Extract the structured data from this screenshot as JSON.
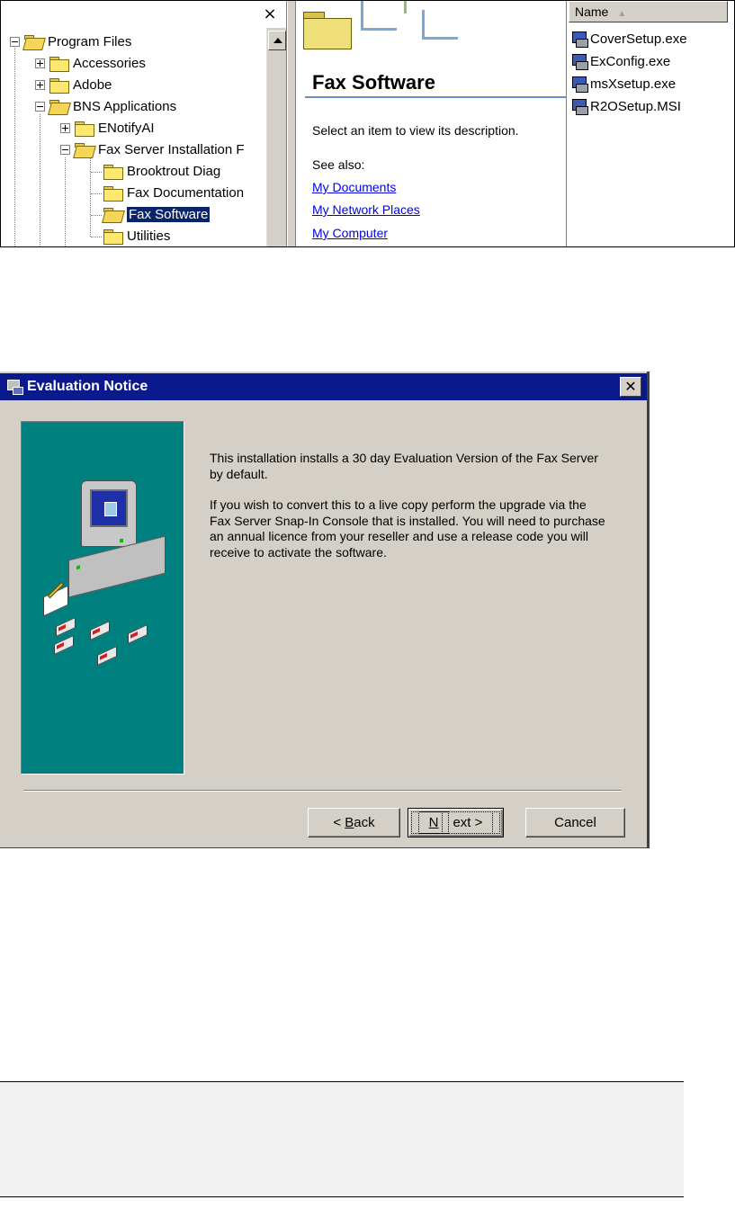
{
  "explorer": {
    "close_glyph": "×",
    "tree": [
      {
        "label": "Program Files",
        "state": "expanded"
      },
      {
        "label": "Accessories",
        "state": "collapsed"
      },
      {
        "label": "Adobe",
        "state": "collapsed"
      },
      {
        "label": "BNS Applications",
        "state": "expanded"
      },
      {
        "label": "ENotifyAI",
        "state": "collapsed"
      },
      {
        "label": "Fax Server Installation F",
        "state": "expanded"
      },
      {
        "label": "Brooktrout Diag",
        "state": "leaf"
      },
      {
        "label": "Fax Documentation",
        "state": "leaf"
      },
      {
        "label": "Fax Software",
        "state": "selected"
      },
      {
        "label": "Utilities",
        "state": "leaf"
      }
    ],
    "info": {
      "title": "Fax Software",
      "description": "Select an item to view its description.",
      "see_also": "See also:",
      "links": [
        "My Documents",
        "My Network Places",
        "My Computer"
      ]
    },
    "files": {
      "column_header": "Name",
      "sort_glyph": "▲",
      "items": [
        "CoverSetup.exe",
        "ExConfig.exe",
        "msXsetup.exe",
        "R2OSetup.MSI"
      ]
    }
  },
  "dialog": {
    "title": "Evaluation Notice",
    "close_glyph": "✕",
    "paragraphs": [
      "This installation installs a 30 day Evaluation Version of the Fax Server by default.",
      "If you wish to convert this to a live copy perform the upgrade via the Fax Server Snap-In Console that is installed. You will need to purchase an annual licence from your reseller and use a release code you will receive to activate the software."
    ],
    "buttons": {
      "back_prefix": "< ",
      "back_mnemonic": "B",
      "back_rest": "ack",
      "next_mnemonic": "N",
      "next_rest": "ext >",
      "cancel": "Cancel"
    }
  },
  "colors": {
    "titlebar": "#0a1a8c",
    "teal_panel": "#007f7f",
    "selection": "#0a246a",
    "link": "#0000ee"
  }
}
